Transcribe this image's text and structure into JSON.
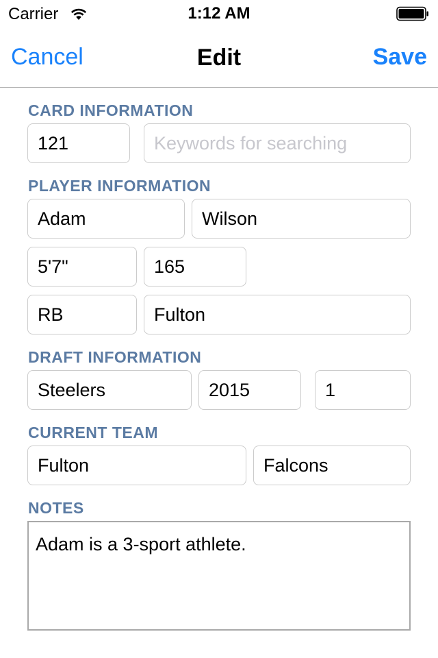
{
  "status_bar": {
    "carrier": "Carrier",
    "time": "1:12 AM",
    "wifi_icon": "wifi-icon",
    "battery_icon": "battery-icon"
  },
  "nav": {
    "cancel_label": "Cancel",
    "title": "Edit",
    "save_label": "Save",
    "accent_color": "#1a82fb"
  },
  "sections": {
    "card_information": "CARD INFORMATION",
    "player_information": "PLAYER INFORMATION",
    "draft_information": "DRAFT INFORMATION",
    "current_team": "CURRENT TEAM",
    "notes": "NOTES",
    "label_color": "#5b7ba3"
  },
  "card": {
    "number": "121",
    "keywords_value": "",
    "keywords_placeholder": "Keywords for searching"
  },
  "player": {
    "first_name": "Adam",
    "last_name": "Wilson",
    "height": "5'7\"",
    "weight": "165",
    "position": "RB",
    "school": "Fulton"
  },
  "draft": {
    "team": "Steelers",
    "year": "2015",
    "round": "1"
  },
  "current_team": {
    "city": "Fulton",
    "name": "Falcons"
  },
  "notes": {
    "text": "Adam is a 3-sport athlete."
  }
}
